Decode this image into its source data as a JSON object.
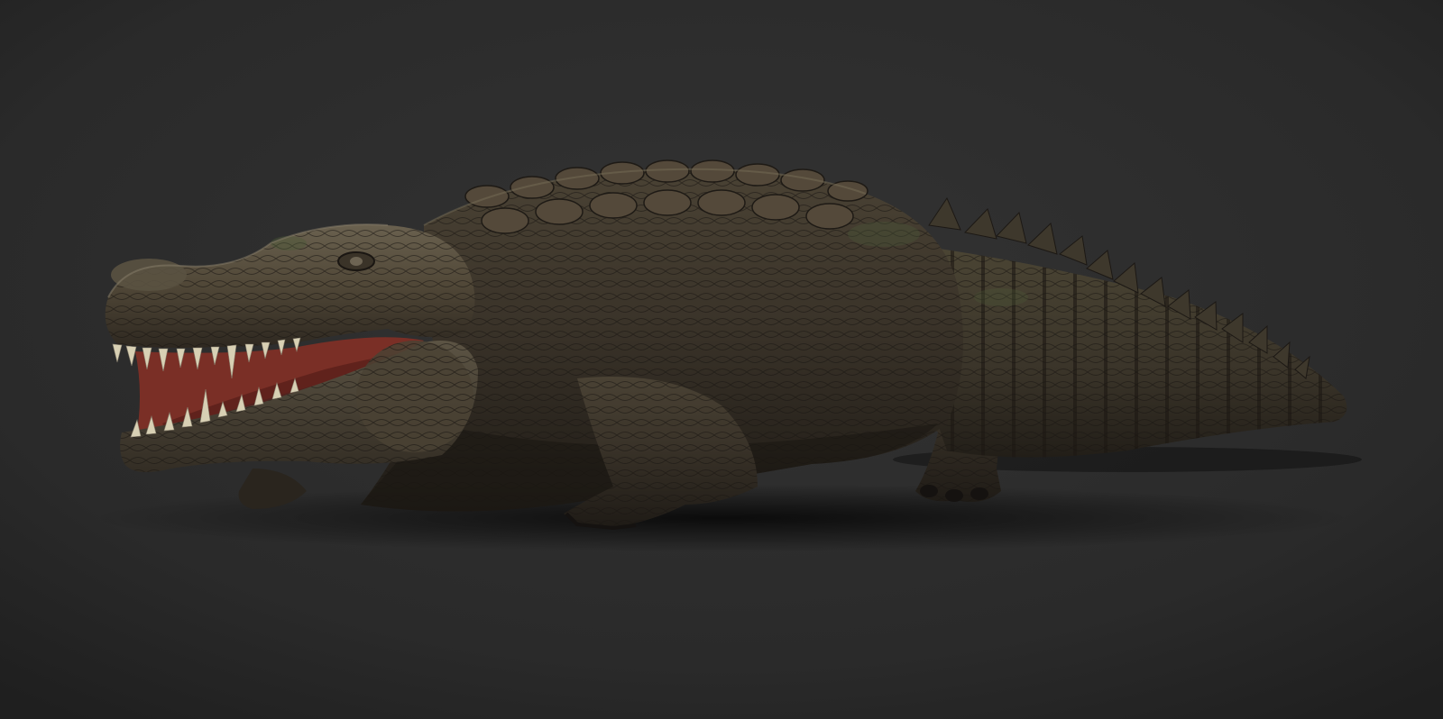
{
  "scene": {
    "background_color": "#2a2a2a",
    "floor_color": "#232323",
    "subject": "crocodile-3d-render",
    "palette": {
      "skin_dark": "#2b2620",
      "skin_mid": "#4a4234",
      "skin_light": "#6d6453",
      "moss": "#4b5a38",
      "mouth": "#7a2f26",
      "teeth": "#d8d0b4"
    }
  }
}
